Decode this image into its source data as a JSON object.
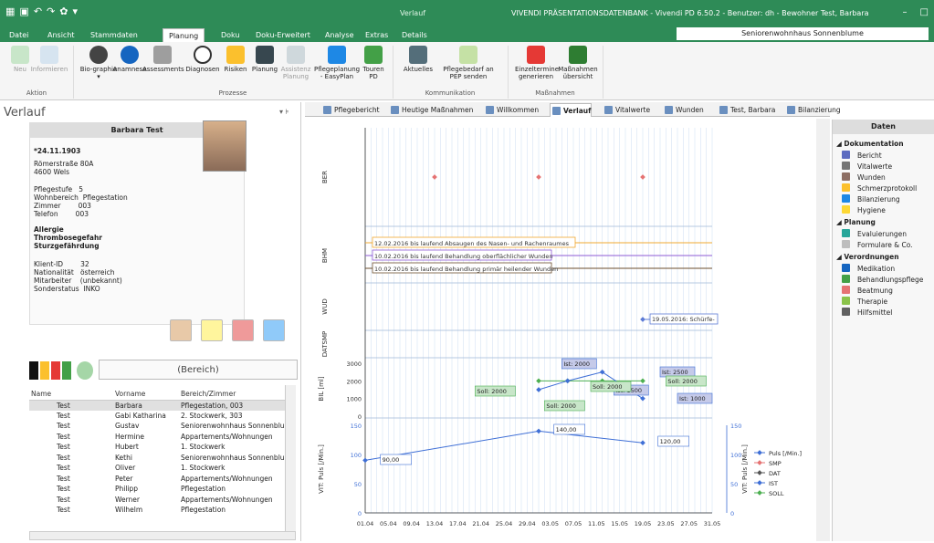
{
  "window": {
    "context_tab": "Verlauf",
    "title": "VIVENDI PRÄSENTATIONSDATENBANK - Vivendi PD 6.50.2 - Benutzer: dh - Bewohner Test, Barbara",
    "facility": "Seniorenwohnhaus Sonnenblume"
  },
  "tabs": [
    "Datei",
    "Ansicht",
    "Stammdaten",
    "Planung",
    "Doku",
    "Doku-Erweitert",
    "Analyse",
    "Extras",
    "Details"
  ],
  "ribbon": {
    "buttons": [
      {
        "label": "Neu",
        "disabled": true
      },
      {
        "label": "Informieren",
        "disabled": true
      },
      {
        "label": "Bio-graphie ▾"
      },
      {
        "label": "Anamnese"
      },
      {
        "label": "Assessments"
      },
      {
        "label": "Diagnosen"
      },
      {
        "label": "Risiken"
      },
      {
        "label": "Planung"
      },
      {
        "label": "Assistenz Planung",
        "disabled": true
      },
      {
        "label": "Pflegeplanung - EasyPlan"
      },
      {
        "label": "Touren PD"
      },
      {
        "label": "Aktuelles"
      },
      {
        "label": "Pflegebedarf an PEP senden"
      },
      {
        "label": "Einzeltermine generieren"
      },
      {
        "label": "Maßnahmen übersicht"
      }
    ],
    "groups": [
      "Aktion",
      "Prozesse",
      "Kommunikation",
      "Maßnahmen"
    ]
  },
  "left": {
    "title": "Verlauf",
    "patient": {
      "name": "Barbara Test",
      "dob": "*24.11.1903",
      "street": "Römerstraße 80A",
      "city": "4600 Wels",
      "info": "Pflegestufe   5\nWohnbereich  Pflegestation\nZimmer        003\nTelefon        003",
      "alerts": "Allergie\nThrombosegefahr\nSturzgefährdung",
      "meta": "Klient-ID        32\nNationalität   österreich\nMitarbeiter    (unbekannt)\nSonderstatus  INKO"
    },
    "bereich": "(Bereich)",
    "columns": [
      "Name",
      "Vorname",
      "Bereich/Zimmer"
    ],
    "rows": [
      [
        "Test",
        "Barbara",
        "Pflegestation, 003"
      ],
      [
        "Test",
        "Gabi Katharina",
        "2. Stockwerk, 303"
      ],
      [
        "Test",
        "Gustav",
        "Seniorenwohnhaus Sonnenblume"
      ],
      [
        "Test",
        "Hermine",
        "Appartements/Wohnungen"
      ],
      [
        "Test",
        "Hubert",
        "1. Stockwerk"
      ],
      [
        "Test",
        "Kethi",
        "Seniorenwohnhaus Sonnenblume"
      ],
      [
        "Test",
        "Oliver",
        "1. Stockwerk"
      ],
      [
        "Test",
        "Peter",
        "Appartements/Wohnungen"
      ],
      [
        "Test",
        "Philipp",
        "Pflegestation"
      ],
      [
        "Test",
        "Werner",
        "Appartements/Wohnungen"
      ],
      [
        "Test",
        "Wilhelm",
        "Pflegestation"
      ]
    ]
  },
  "doctabs": [
    "Pflegebericht",
    "Heutige Maßnahmen",
    "Willkommen",
    "Verlauf",
    "Vitalwerte",
    "Wunden",
    "Test, Barbara",
    "Bilanzierung"
  ],
  "right": {
    "header": "Daten",
    "sections": [
      {
        "title": "Dokumentation",
        "items": [
          "Bericht",
          "Vitalwerte",
          "Wunden",
          "Schmerzprotokoll",
          "Bilanzierung",
          "Hygiene"
        ]
      },
      {
        "title": "Planung",
        "items": [
          "Evaluierungen",
          "Formulare & Co."
        ]
      },
      {
        "title": "Verordnungen",
        "items": [
          "Medikation",
          "Behandlungspflege",
          "Beatmung",
          "Therapie",
          "Hilfsmittel"
        ]
      }
    ]
  },
  "chart_data": {
    "type": "line",
    "x_ticks": [
      "01.04",
      "05.04",
      "09.04",
      "13.04",
      "17.04",
      "21.04",
      "25.04",
      "29.04",
      "03.05",
      "07.05",
      "11.05",
      "15.05",
      "19.05",
      "23.05",
      "27.05",
      "31.05"
    ],
    "lanes": [
      {
        "label": "BER"
      },
      {
        "label": "BHM",
        "entries": [
          "12.02.2016 bis laufend Absaugen des Nasen- und Rachenraumes",
          "10.02.2016 bis laufend Behandlung oberflächlicher Wunden",
          "10.02.2016 bis laufend Behandlung primär heilender Wunden"
        ]
      },
      {
        "label": "WUD",
        "entries": [
          "19.05.2016: Schürfe-"
        ]
      },
      {
        "label": "DATSMP"
      }
    ],
    "bil": {
      "ylabel": "BIL [ml]",
      "ylim": [
        0,
        3000
      ],
      "ticks": [
        "3000",
        "2000",
        "1000",
        "0"
      ],
      "ist_labels": [
        "Ist: 2000",
        "Ist: 1500",
        "Ist: 2500",
        "Ist: 1000"
      ],
      "soll_labels": [
        "Soll: 2000",
        "Soll: 2000",
        "Soll: 2000",
        "Soll: 2000"
      ]
    },
    "vit": {
      "ylabel": "VIT: Puls [/Min.]",
      "ylabel_right": "VIT: Puls [/Min.]",
      "ylim": [
        0,
        150
      ],
      "ticks": [
        "150",
        "100",
        "50",
        "0"
      ],
      "labels": [
        "90,00",
        "140,00",
        "120,00"
      ],
      "legend": [
        "Puls [/Min.]",
        "SMP",
        "DAT",
        "IST",
        "SOLL"
      ]
    }
  }
}
